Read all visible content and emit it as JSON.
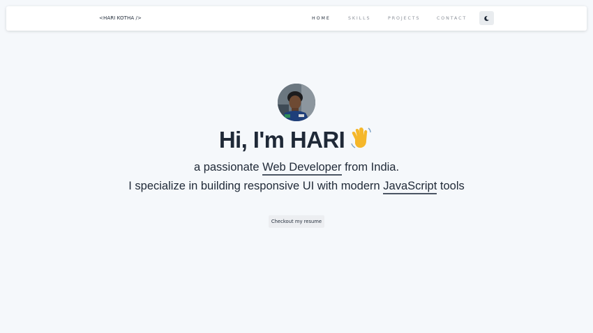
{
  "nav": {
    "brand": "<HARI KOTHA />",
    "links": [
      {
        "label": "HOME",
        "active": true
      },
      {
        "label": "SKILLS",
        "active": false
      },
      {
        "label": "PROJECTS",
        "active": false
      },
      {
        "label": "CONTACT",
        "active": false
      }
    ],
    "theme_toggle_icon": "moon-icon"
  },
  "hero": {
    "greeting": "Hi, I'm HARI",
    "greeting_emoji_icon": "waving-hand-icon",
    "line1_prefix": "a passionate ",
    "line1_highlight": "Web Developer",
    "line1_suffix": " from India.",
    "line2_prefix": "I specialize in building responsive UI with modern ",
    "line2_highlight": "JavaScript",
    "line2_suffix": " tools",
    "resume_button": "Checkout my resume"
  },
  "colors": {
    "background": "#f5f8fb",
    "text": "#1f2937",
    "muted_nav": "#8a8f98",
    "underline": "#4b5563"
  }
}
